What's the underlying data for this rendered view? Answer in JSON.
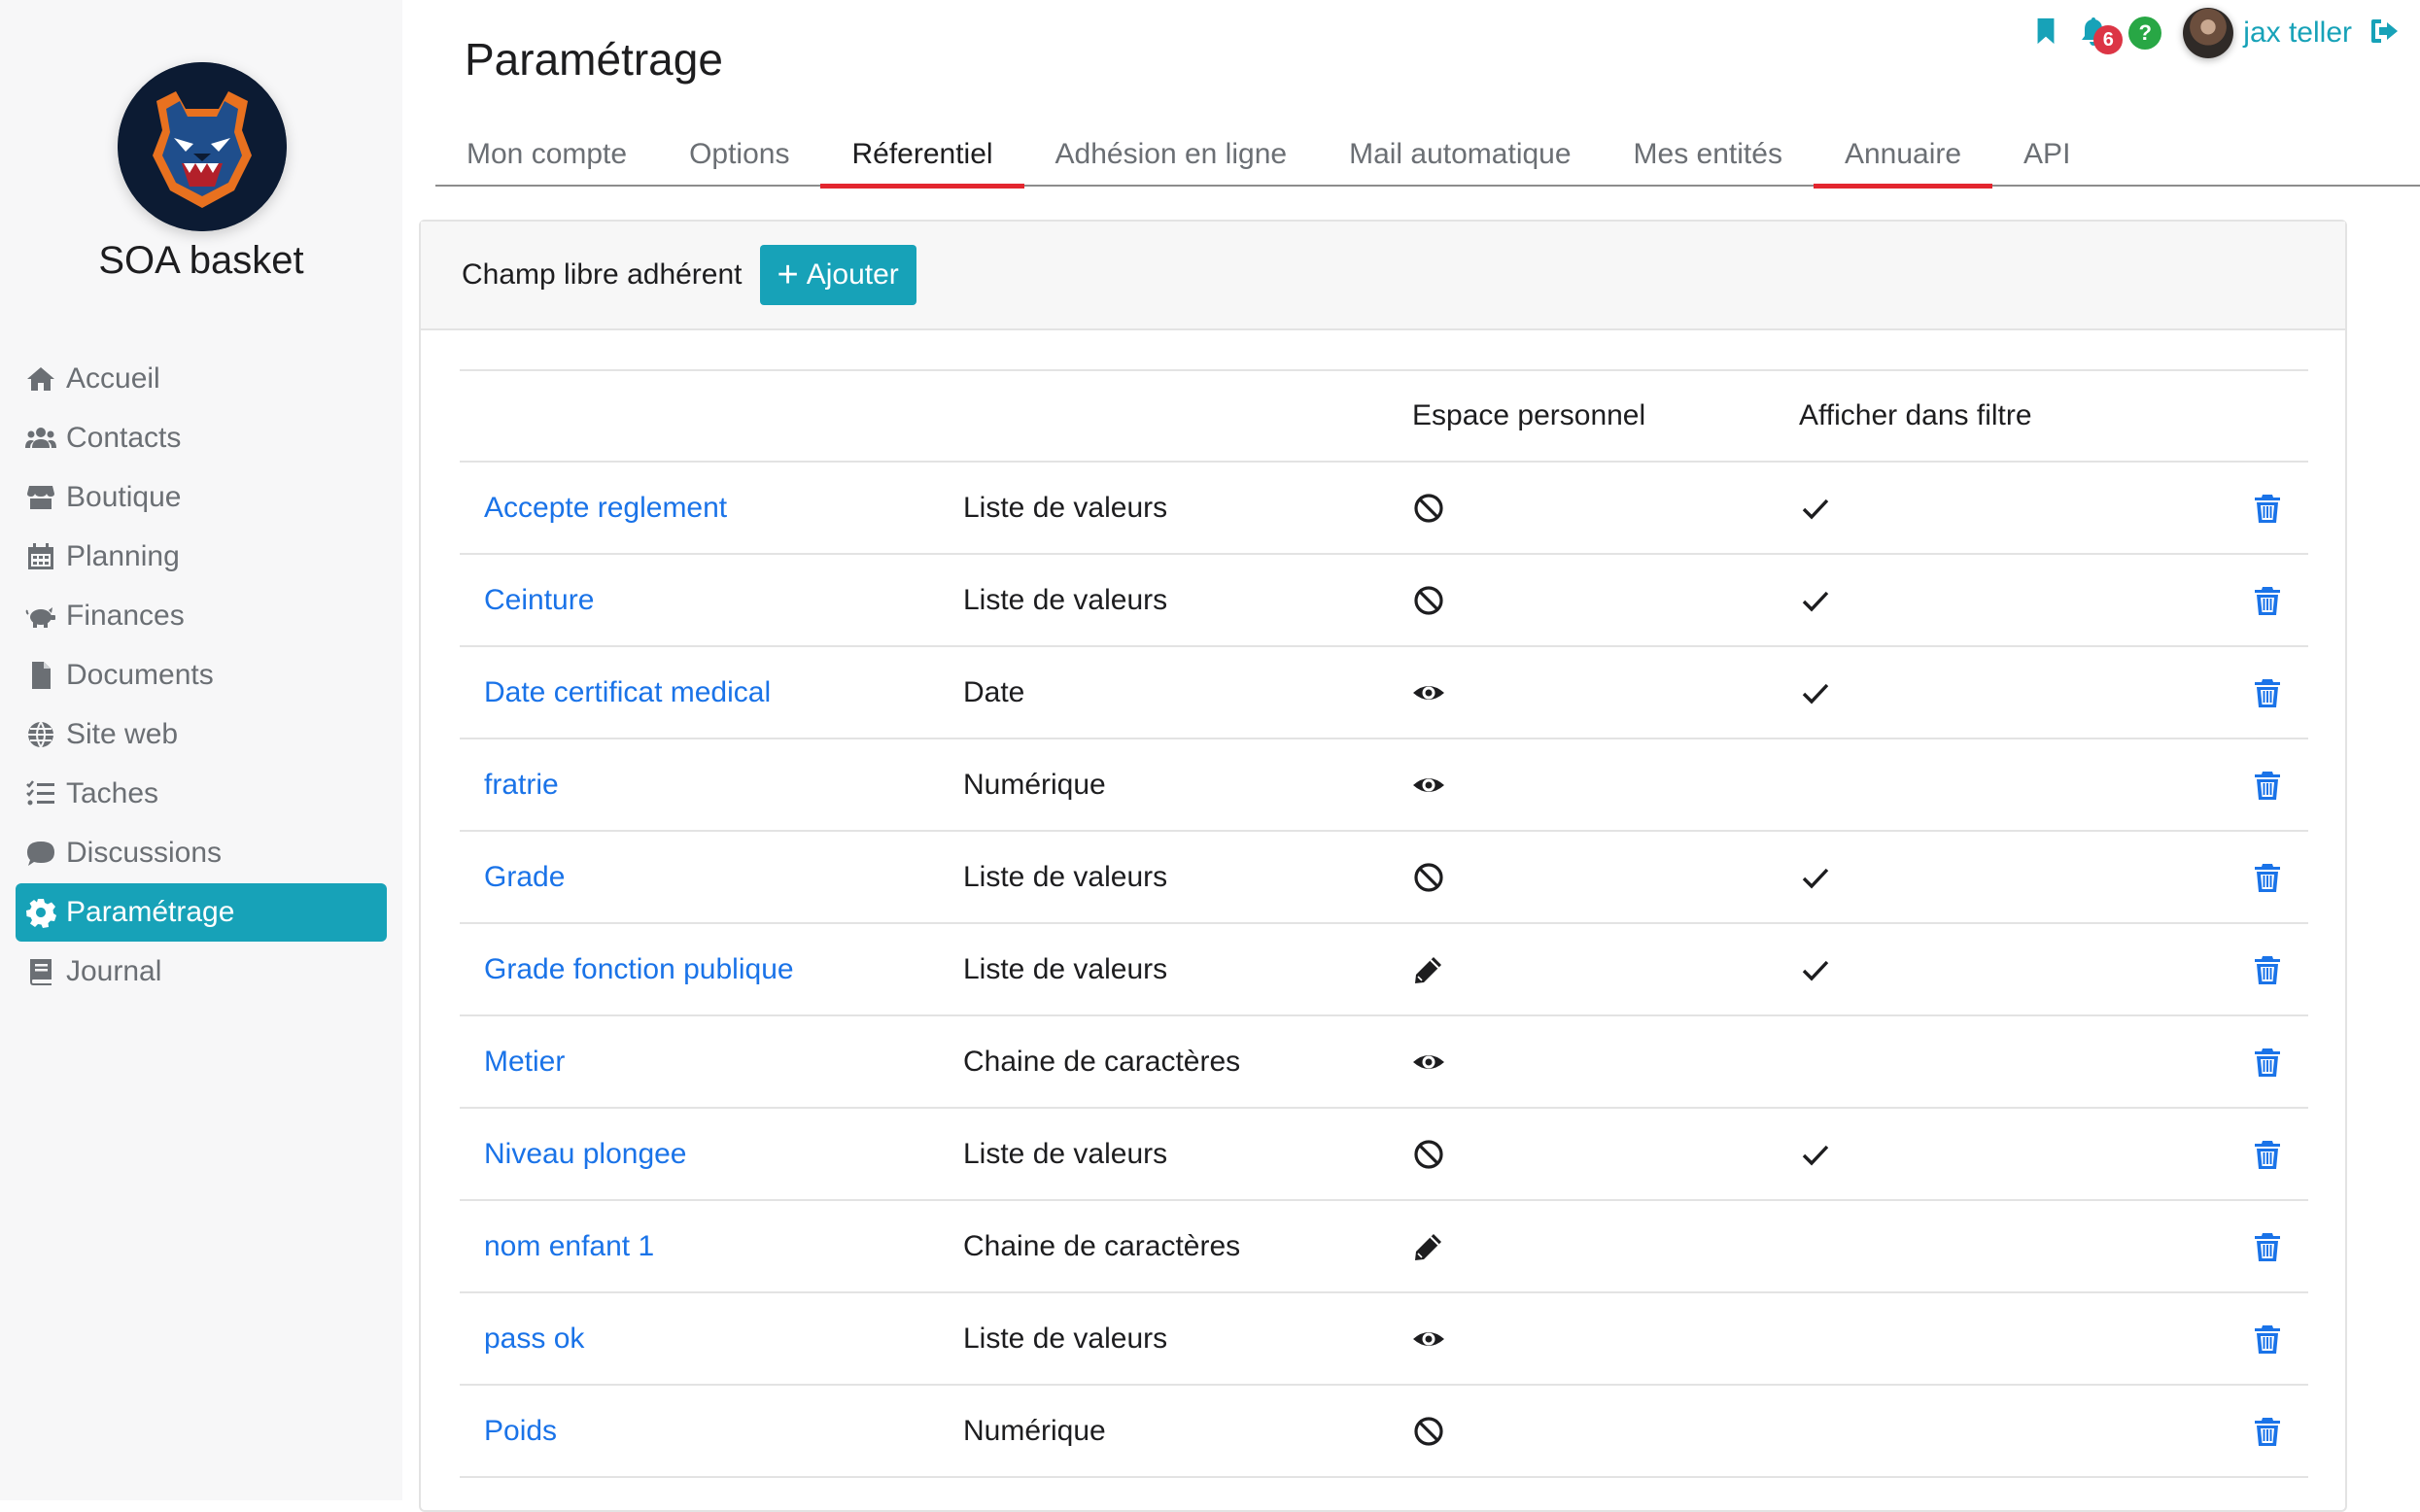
{
  "app": {
    "club_name": "SOA basket",
    "accent_color": "#17a2b8",
    "link_color": "#1a73e8",
    "tab_marker_color": "#e3262f"
  },
  "sidebar": {
    "items": [
      {
        "label": "Accueil",
        "icon": "home-icon",
        "active": false
      },
      {
        "label": "Contacts",
        "icon": "users-icon",
        "active": false
      },
      {
        "label": "Boutique",
        "icon": "store-icon",
        "active": false
      },
      {
        "label": "Planning",
        "icon": "calendar-icon",
        "active": false
      },
      {
        "label": "Finances",
        "icon": "piggy-bank-icon",
        "active": false
      },
      {
        "label": "Documents",
        "icon": "file-icon",
        "active": false
      },
      {
        "label": "Site web",
        "icon": "globe-icon",
        "active": false
      },
      {
        "label": "Taches",
        "icon": "tasks-icon",
        "active": false
      },
      {
        "label": "Discussions",
        "icon": "comment-icon",
        "active": false
      },
      {
        "label": "Paramétrage",
        "icon": "gear-icon",
        "active": true
      },
      {
        "label": "Journal",
        "icon": "book-icon",
        "active": false
      }
    ]
  },
  "topbar": {
    "notification_count": "6",
    "help_label": "?",
    "username": "jax teller"
  },
  "page": {
    "title": "Paramétrage"
  },
  "tabs": [
    {
      "label": "Mon compte"
    },
    {
      "label": "Options"
    },
    {
      "label": "Réferentiel"
    },
    {
      "label": "Adhésion en ligne"
    },
    {
      "label": "Mail automatique"
    },
    {
      "label": "Mes entités"
    },
    {
      "label": "Annuaire"
    },
    {
      "label": "API"
    }
  ],
  "card": {
    "header_label": "Champ libre adhérent",
    "add_button_label": "Ajouter"
  },
  "table": {
    "columns": [
      "",
      "",
      "Espace personnel",
      "Afficher dans filtre",
      ""
    ],
    "rows": [
      {
        "name": "Accepte reglement",
        "type": "Liste de valeurs",
        "espace": "ban-icon",
        "filtre": true
      },
      {
        "name": "Ceinture",
        "type": "Liste de valeurs",
        "espace": "ban-icon",
        "filtre": true
      },
      {
        "name": "Date certificat medical",
        "type": "Date",
        "espace": "eye-icon",
        "filtre": true
      },
      {
        "name": "fratrie",
        "type": "Numérique",
        "espace": "eye-icon",
        "filtre": false
      },
      {
        "name": "Grade",
        "type": "Liste de valeurs",
        "espace": "ban-icon",
        "filtre": true
      },
      {
        "name": "Grade fonction publique",
        "type": "Liste de valeurs",
        "espace": "pencil-icon",
        "filtre": true
      },
      {
        "name": "Metier",
        "type": "Chaine de caractères",
        "espace": "eye-icon",
        "filtre": false
      },
      {
        "name": "Niveau plongee",
        "type": "Liste de valeurs",
        "espace": "ban-icon",
        "filtre": true
      },
      {
        "name": "nom enfant 1",
        "type": "Chaine de caractères",
        "espace": "pencil-icon",
        "filtre": false
      },
      {
        "name": "pass ok",
        "type": "Liste de valeurs",
        "espace": "eye-icon",
        "filtre": false
      },
      {
        "name": "Poids",
        "type": "Numérique",
        "espace": "ban-icon",
        "filtre": false
      }
    ]
  }
}
